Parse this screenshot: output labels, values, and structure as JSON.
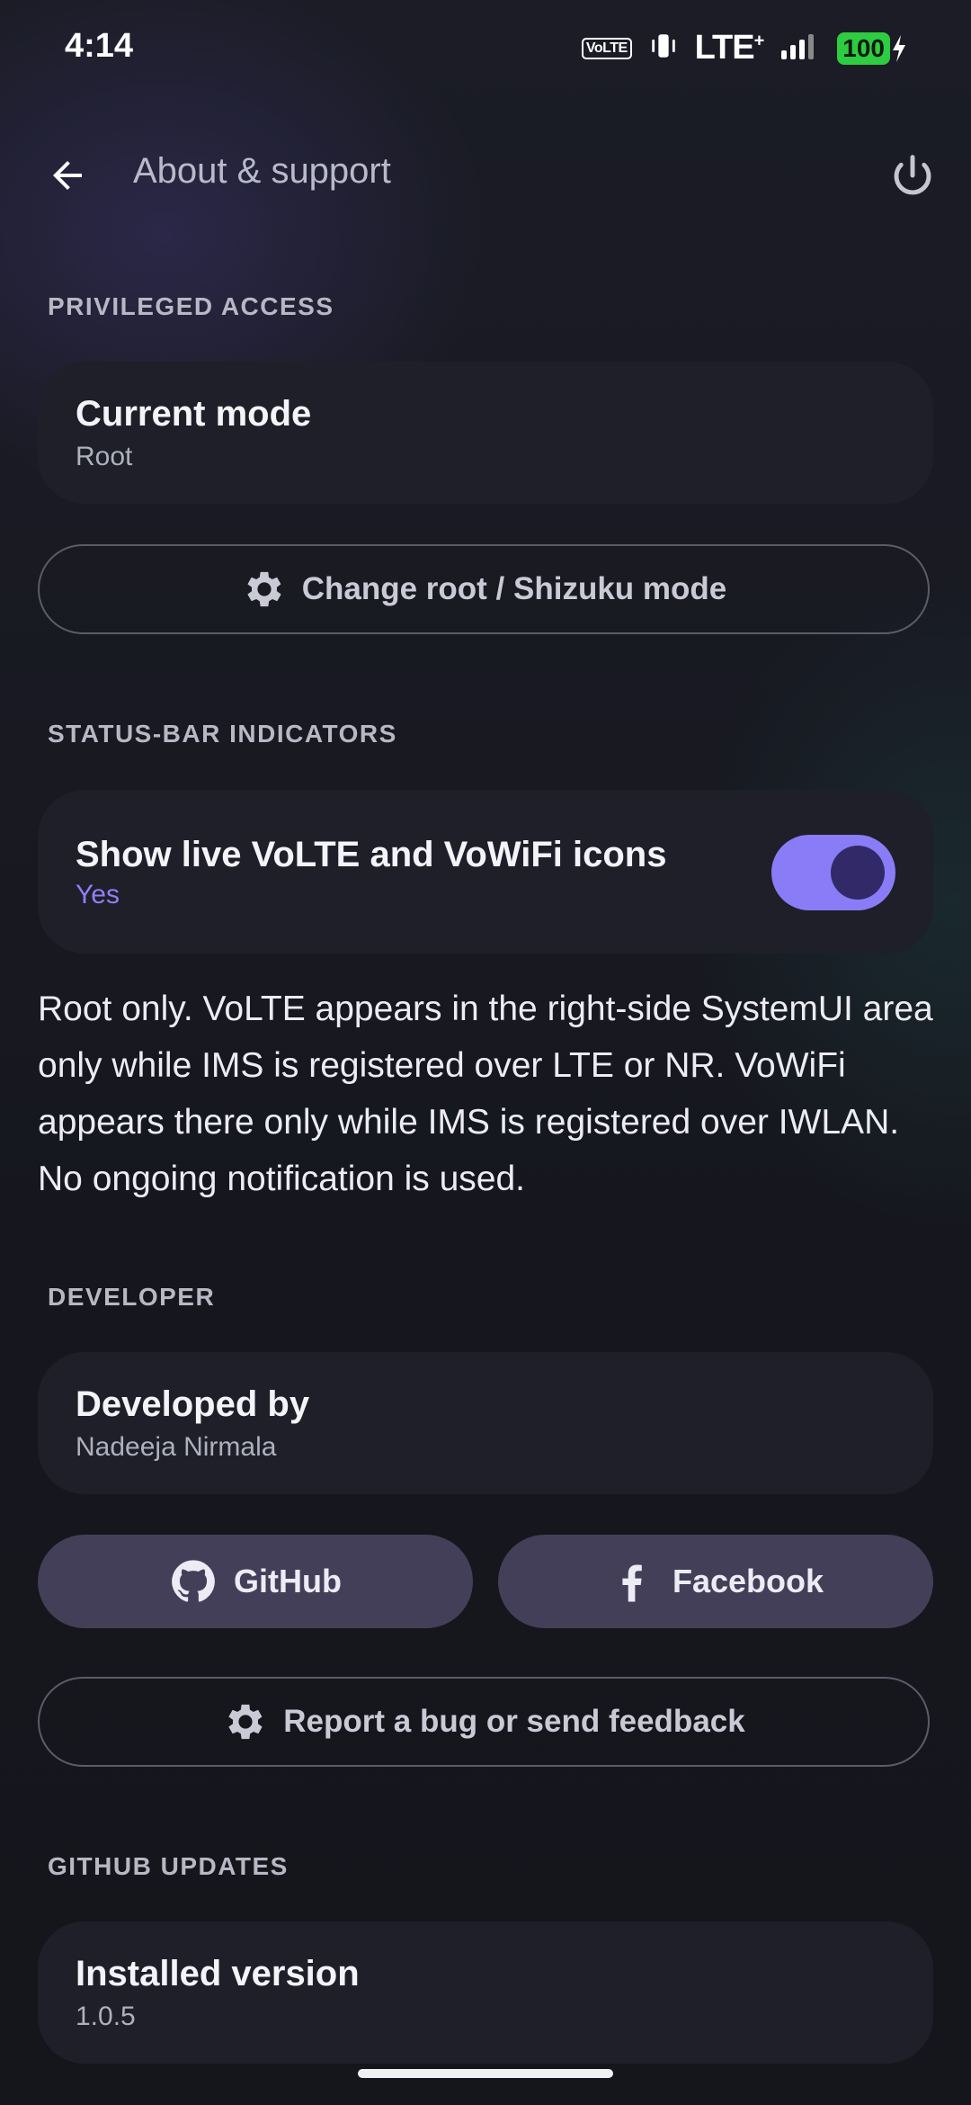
{
  "status_bar": {
    "time": "4:14",
    "volte_badge": "VoLTE",
    "network": "LTE",
    "network_plus": "+",
    "battery": "100"
  },
  "header": {
    "title": "About & support",
    "back_icon": "arrow-back-icon",
    "power_icon": "power-icon"
  },
  "sections": {
    "privileged": {
      "label": "PRIVILEGED ACCESS",
      "mode_title": "Current mode",
      "mode_value": "Root",
      "change_button": "Change root / Shizuku mode"
    },
    "statusbar": {
      "label": "STATUS-BAR INDICATORS",
      "toggle_title": "Show live VoLTE and VoWiFi icons",
      "toggle_value": "Yes",
      "toggle_on": true,
      "description": "Root only. VoLTE appears in the right-side SystemUI area only while IMS is registered over LTE or NR. VoWiFi appears there only while IMS is registered over IWLAN. No ongoing notification is used."
    },
    "developer": {
      "label": "DEVELOPER",
      "dev_title": "Developed by",
      "dev_name": "Nadeeja Nirmala",
      "github_button": "GitHub",
      "facebook_button": "Facebook",
      "report_button": "Report a bug or send feedback"
    },
    "updates": {
      "label": "GITHUB UPDATES",
      "installed_title": "Installed version",
      "installed_value": "1.0.5"
    }
  },
  "colors": {
    "accent": "#8a7cf6",
    "accent_text": "#8f7ff7",
    "card": "#1e1f29",
    "filled_button": "#443f59"
  }
}
